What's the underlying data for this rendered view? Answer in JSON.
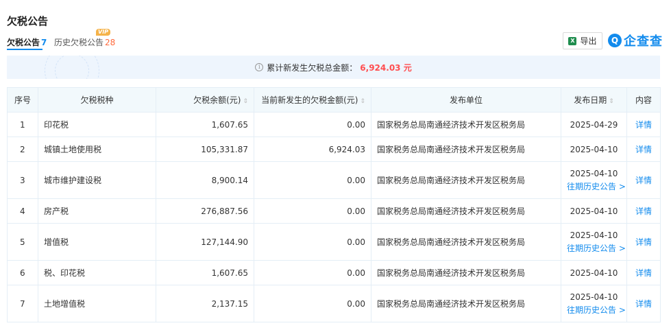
{
  "page": {
    "title": "欠税公告",
    "tabs": [
      {
        "label": "欠税公告",
        "count": "7"
      },
      {
        "label": "历史欠税公告",
        "count": "28",
        "badge": "VIP"
      }
    ],
    "export_label": "导出",
    "export_icon": "excel-icon",
    "logo_text": "企查查",
    "logo_mark": "Q"
  },
  "summary": {
    "label": "累计新发生欠税总金额：",
    "amount": "6,924.03 元",
    "icon": "info-icon"
  },
  "table": {
    "headers": [
      "序号",
      "欠税税种",
      "欠税余额(元)",
      "当前新发生的欠税金额(元)",
      "发布单位",
      "发布日期",
      "内容"
    ],
    "sort_icon": "⇕",
    "rows": [
      {
        "seq": "1",
        "type": "印花税",
        "balance": "1,607.65",
        "new_amount": "0.00",
        "org": "国家税务总局南通经济技术开发区税务局",
        "date": "2025-04-29",
        "history": "",
        "action": "详情"
      },
      {
        "seq": "2",
        "type": "城镇土地使用税",
        "balance": "105,331.87",
        "new_amount": "6,924.03",
        "org": "国家税务总局南通经济技术开发区税务局",
        "date": "2025-04-10",
        "history": "",
        "action": "详情"
      },
      {
        "seq": "3",
        "type": "城市维护建设税",
        "balance": "8,900.14",
        "new_amount": "0.00",
        "org": "国家税务总局南通经济技术开发区税务局",
        "date": "2025-04-10",
        "history": "往期历史公告 >",
        "action": "详情"
      },
      {
        "seq": "4",
        "type": "房产税",
        "balance": "276,887.56",
        "new_amount": "0.00",
        "org": "国家税务总局南通经济技术开发区税务局",
        "date": "2025-04-10",
        "history": "",
        "action": "详情"
      },
      {
        "seq": "5",
        "type": "增值税",
        "balance": "127,144.90",
        "new_amount": "0.00",
        "org": "国家税务总局南通经济技术开发区税务局",
        "date": "2025-04-10",
        "history": "往期历史公告 >",
        "action": "详情"
      },
      {
        "seq": "6",
        "type": "税、印花税",
        "balance": "1,607.65",
        "new_amount": "0.00",
        "org": "国家税务总局南通经济技术开发区税务局",
        "date": "2025-04-10",
        "history": "",
        "action": "详情"
      },
      {
        "seq": "7",
        "type": "土地增值税",
        "balance": "2,137.15",
        "new_amount": "0.00",
        "org": "国家税务总局南通经济技术开发区税务局",
        "date": "2025-04-10",
        "history": "往期历史公告 >",
        "action": "详情"
      }
    ]
  },
  "colors": {
    "accent": "#128bed",
    "amount": "#ff4d4f",
    "count_history": "#ff6a3c",
    "vip": "#f5b34a",
    "header_bg": "#f2f9fc",
    "summary_bg": "#eef5fd"
  }
}
